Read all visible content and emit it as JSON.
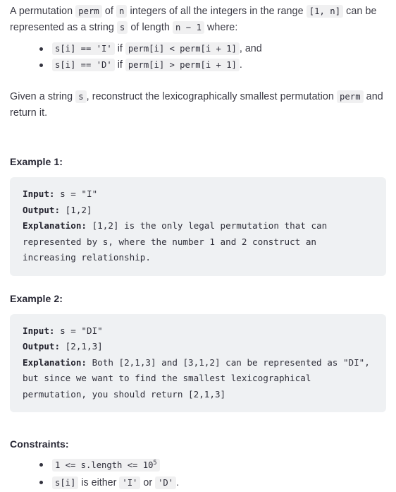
{
  "document": {
    "intro": {
      "line1_part1": "A permutation ",
      "code_perm": "perm",
      "line1_part2": " of ",
      "code_n": "n",
      "line1_part3": " integers of all the integers in the range ",
      "code_range": "[1, n]",
      "line1_part4": " can be represented as a string ",
      "code_s": "s",
      "line1_part5": " of length ",
      "code_len": "n − 1",
      "line1_part6": " where:"
    },
    "rules": [
      {
        "code_left": "s[i] == 'I'",
        "mid": " if ",
        "code_right": "perm[i] < perm[i + 1]",
        "tail": ", and"
      },
      {
        "code_left": "s[i] == 'D'",
        "mid": " if ",
        "code_right": "perm[i] > perm[i + 1]",
        "tail": "."
      }
    ],
    "given": {
      "part1": "Given a string ",
      "code_s": "s",
      "part2": ", reconstruct the lexicographically smallest permutation ",
      "code_perm": "perm",
      "part3": " and return it."
    },
    "examples": [
      {
        "heading": "Example 1:",
        "input_label": "Input:",
        "input_value": " s = \"I\"",
        "output_label": "Output:",
        "output_value": " [1,2]",
        "explanation_label": "Explanation:",
        "explanation_value": " [1,2] is the only legal permutation that can\nrepresented by s, where the number 1 and 2 construct an\nincreasing relationship."
      },
      {
        "heading": "Example 2:",
        "input_label": "Input:",
        "input_value": " s = \"DI\"",
        "output_label": "Output:",
        "output_value": " [2,1,3]",
        "explanation_label": "Explanation:",
        "explanation_value": " Both [2,1,3] and [3,1,2] can be represented as \"DI\",\nbut since we want to find the smallest lexicographical\npermutation, you should return [2,1,3]"
      }
    ],
    "constraints": {
      "heading": "Constraints:",
      "items": [
        {
          "code_main": "1 <= s.length <= 10",
          "code_sup": "5",
          "tail": ""
        },
        {
          "code_first": "s[i]",
          "mid": " is either ",
          "code_second": "'I'",
          "mid2": " or ",
          "code_third": "'D'",
          "tail": "."
        }
      ]
    }
  },
  "colors": {
    "code_block_bg": "#eff1f3",
    "inline_code_bg": "#f0f0f1",
    "text": "#3b3b45",
    "heading": "#262633",
    "page_bg": "#ffffff"
  }
}
